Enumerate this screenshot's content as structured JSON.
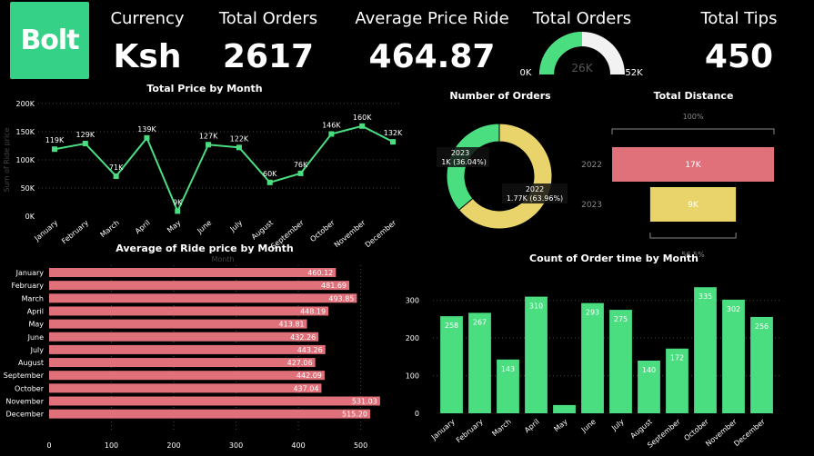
{
  "logo": {
    "text": "Bolt",
    "color": "#34D186"
  },
  "kpis": {
    "currency_title": "Currency",
    "currency_value": "Ksh",
    "orders_title": "Total Orders",
    "orders_value": "2617",
    "avg_title": "Average Price Ride",
    "avg_value": "464.87",
    "gauge_title": "Total Orders",
    "gauge_min": "0K",
    "gauge_center": "26K",
    "gauge_max": "52K",
    "tips_title": "Total Tips",
    "tips_value": "450"
  },
  "colors": {
    "green": "#4ADE80",
    "red": "#E0707A",
    "yellow": "#E8D46A",
    "gauge_bg": "#F2F2F2"
  },
  "chart_data": [
    {
      "id": "total-price",
      "type": "line",
      "title": "Total Price by Month",
      "ylabel": "Sum of Ride price",
      "xlabel": "Month",
      "ylim": [
        0,
        200000
      ],
      "yticks": [
        "0K",
        "50K",
        "100K",
        "150K",
        "200K"
      ],
      "categories": [
        "January",
        "February",
        "March",
        "April",
        "May",
        "June",
        "July",
        "August",
        "September",
        "October",
        "November",
        "December"
      ],
      "values": [
        119000,
        129000,
        71000,
        139000,
        9000,
        127000,
        122000,
        60000,
        76000,
        146000,
        160000,
        132000
      ],
      "labels": [
        "119K",
        "129K",
        "71K",
        "139K",
        "9K",
        "127K",
        "122K",
        "60K",
        "76K",
        "146K",
        "160K",
        "132K"
      ]
    },
    {
      "id": "number-orders",
      "type": "pie",
      "title": "Number of Orders",
      "slices": [
        {
          "label": "2022",
          "value": 1770,
          "text": "1.77K (63.96%)"
        },
        {
          "label": "2023",
          "value": 1000,
          "text": "1K (36.04%)"
        }
      ]
    },
    {
      "id": "total-distance",
      "type": "bar",
      "title": "Total Distance",
      "categories": [
        "2022",
        "2023"
      ],
      "values": [
        17,
        9
      ],
      "labels": [
        "17K",
        "9K"
      ],
      "top_pct": "100%",
      "bottom_pct": "56.5%"
    },
    {
      "id": "avg-price",
      "type": "bar",
      "title": "Average of Ride price by Month",
      "categories": [
        "January",
        "February",
        "March",
        "April",
        "May",
        "June",
        "July",
        "August",
        "September",
        "October",
        "November",
        "December"
      ],
      "values": [
        460.12,
        481.69,
        493.85,
        448.19,
        413.81,
        432.26,
        443.26,
        427.06,
        442.09,
        437.04,
        531.03,
        515.2
      ],
      "labels": [
        "460.12",
        "481.69",
        "493.85",
        "448.19",
        "413.81",
        "432.26",
        "443.26",
        "427.06",
        "442.09",
        "437.04",
        "531.03",
        "515.20"
      ],
      "xlim": [
        0,
        540
      ],
      "xticks": [
        "0",
        "100",
        "200",
        "300",
        "400",
        "500"
      ]
    },
    {
      "id": "order-count",
      "type": "bar",
      "title": "Count of Order time by Month",
      "categories": [
        "January",
        "February",
        "March",
        "April",
        "May",
        "June",
        "July",
        "August",
        "September",
        "October",
        "November",
        "December"
      ],
      "values": [
        258,
        267,
        143,
        310,
        22,
        293,
        275,
        140,
        172,
        335,
        302,
        256
      ],
      "labels": [
        "258",
        "267",
        "143",
        "310",
        "",
        "293",
        "275",
        "140",
        "172",
        "335",
        "302",
        "256"
      ],
      "ylim": [
        0,
        350
      ],
      "yticks": [
        "0",
        "100",
        "200",
        "300"
      ]
    }
  ]
}
